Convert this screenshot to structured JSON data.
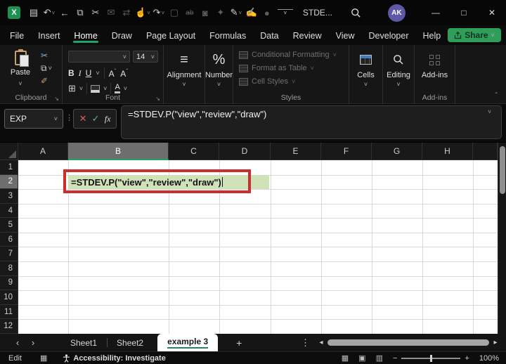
{
  "colors": {
    "accent_green": "#21a366",
    "share_green": "#2f9e5a",
    "avatar_purple": "#5e59a6",
    "cell_green": "#cfe2b8",
    "annotation_red": "#c92f2c",
    "header_selected": "#6e6e6e",
    "grid_line": "#d9d9d9"
  },
  "titlebar": {
    "logo": "X",
    "title": "STDE...",
    "avatar": "AK",
    "qat": [
      {
        "name": "save-icon",
        "glyph": "▤"
      },
      {
        "name": "undo-icon",
        "glyph": "↶",
        "chevron": true
      },
      {
        "name": "back-icon",
        "glyph": "←"
      },
      {
        "name": "copy-icon",
        "glyph": "⧉"
      },
      {
        "name": "cut-icon",
        "glyph": "✂"
      },
      {
        "name": "mail-pen-icon",
        "glyph": "✉",
        "disabled": true
      },
      {
        "name": "replace-icon",
        "glyph": "⇄",
        "disabled": true
      },
      {
        "name": "touch-mode-icon",
        "glyph": "☝",
        "chevron": true
      },
      {
        "name": "redo-icon",
        "glyph": "↷",
        "chevron": true
      },
      {
        "name": "new-document-icon",
        "glyph": "▢",
        "disabled": true
      },
      {
        "name": "strikethrough-icon",
        "glyph": "ab",
        "disabled": true,
        "strike": true
      },
      {
        "name": "camera-icon",
        "glyph": "◙",
        "disabled": true
      },
      {
        "name": "certificate-icon",
        "glyph": "✦",
        "disabled": true
      },
      {
        "name": "ink-pen-icon",
        "glyph": "✎",
        "chevron": true
      },
      {
        "name": "person-lock-icon",
        "glyph": "✍",
        "disabled": true
      },
      {
        "name": "record-icon",
        "glyph": "●",
        "disabled": true
      },
      {
        "name": "qat-overflow-icon",
        "glyph": "˅",
        "overline": true
      }
    ],
    "window": {
      "minimize": "—",
      "maximize": "□",
      "close": "✕"
    }
  },
  "menu": {
    "tabs": [
      {
        "label": "File"
      },
      {
        "label": "Insert"
      },
      {
        "label": "Home",
        "active": true
      },
      {
        "label": "Draw"
      },
      {
        "label": "Page Layout"
      },
      {
        "label": "Formulas"
      },
      {
        "label": "Data"
      },
      {
        "label": "Review"
      },
      {
        "label": "View"
      },
      {
        "label": "Developer"
      },
      {
        "label": "Help"
      }
    ],
    "share_label": "Share"
  },
  "ribbon": {
    "clipboard": {
      "paste": "Paste",
      "label": "Clipboard"
    },
    "font": {
      "size": "14",
      "bold": "B",
      "italic": "I",
      "underline": "U",
      "grow": "A",
      "shrink": "A",
      "color_a": "A",
      "label": "Font"
    },
    "alignment": {
      "label": "Alignment"
    },
    "number": {
      "icon": "%",
      "label": "Number"
    },
    "styles": {
      "items": [
        "Conditional Formatting",
        "Format as Table",
        "Cell Styles"
      ],
      "label": "Styles"
    },
    "cells": {
      "label": "Cells"
    },
    "editing": {
      "label": "Editing"
    },
    "addins": {
      "button": "Add-ins",
      "label": "Add-ins"
    }
  },
  "formula_bar": {
    "name_box": "EXP",
    "cancel": "✕",
    "enter": "✓",
    "fx": "fx",
    "formula": "=STDEV.P(\"view\",\"review\",\"draw\")"
  },
  "grid": {
    "columns": [
      "A",
      "B",
      "C",
      "D",
      "E",
      "F",
      "G",
      "H"
    ],
    "rows": [
      "1",
      "2",
      "3",
      "4",
      "5",
      "6",
      "7",
      "8",
      "9",
      "10",
      "11",
      "12"
    ],
    "selected_column": "B",
    "selected_row": "2",
    "active_cell_text": "=STDEV.P(\"view\",\"review\",\"draw\")"
  },
  "sheet_tabs": {
    "tabs": [
      {
        "label": "Sheet1"
      },
      {
        "label": "Sheet2"
      },
      {
        "label": "example 3",
        "active": true
      }
    ],
    "add": "+",
    "menu": "⋮"
  },
  "status_bar": {
    "mode": "Edit",
    "accessibility": "Accessibility: Investigate",
    "zoom": "100%",
    "zoom_minus": "−",
    "zoom_plus": "+"
  },
  "ui": {
    "chevron_down": "˅",
    "chevron_up": "ˆ",
    "caron": "ˇ",
    "dots": "⋮",
    "launcher": "↘",
    "nav_prev": "‹",
    "nav_next": "›",
    "scroll_left": "◂",
    "scroll_right": "▸",
    "cut": "✂",
    "copy": "⧉",
    "painter": "✐",
    "borders": "⊞",
    "align_lines": "≡",
    "macro": "▦",
    "view_normal": "▦",
    "view_layout": "▣",
    "view_break": "▥"
  }
}
